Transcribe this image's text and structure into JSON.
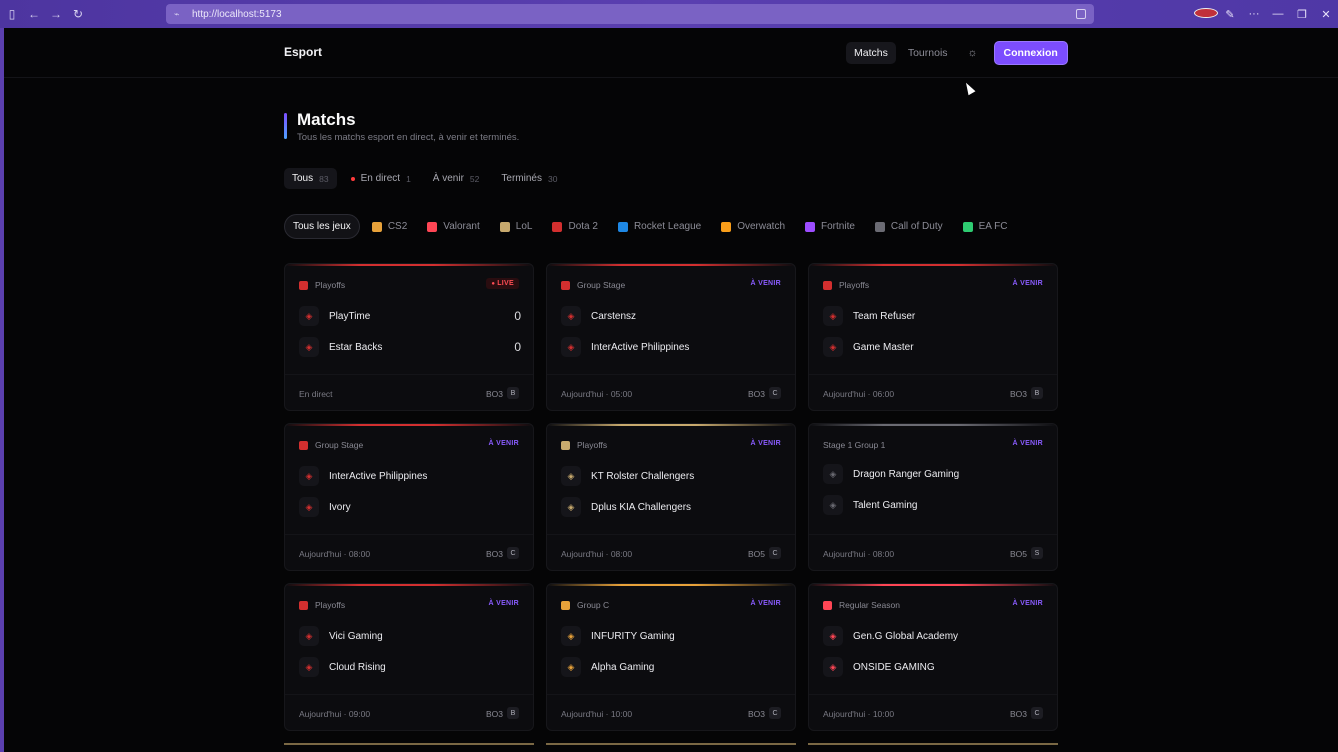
{
  "browser": {
    "url": "http://localhost:5173"
  },
  "nav": {
    "brand": "Esport",
    "links": [
      "Matchs",
      "Tournois"
    ],
    "login": "Connexion"
  },
  "hero": {
    "title": "Matchs",
    "subtitle": "Tous les matchs esport en direct, à venir et terminés."
  },
  "status_tabs": [
    {
      "label": "Tous",
      "count": "83"
    },
    {
      "label": "En direct",
      "count": "1"
    },
    {
      "label": "À venir",
      "count": "52"
    },
    {
      "label": "Terminés",
      "count": "30"
    }
  ],
  "game_filters": [
    {
      "label": "Tous les jeux",
      "color": ""
    },
    {
      "label": "CS2",
      "color": "#e8a23a"
    },
    {
      "label": "Valorant",
      "color": "#ff4655"
    },
    {
      "label": "LoL",
      "color": "#c8aa6e"
    },
    {
      "label": "Dota 2",
      "color": "#d32f2f"
    },
    {
      "label": "Rocket League",
      "color": "#1e88e5"
    },
    {
      "label": "Overwatch",
      "color": "#f99e1a"
    },
    {
      "label": "Fortnite",
      "color": "#9d4dff"
    },
    {
      "label": "Call of Duty",
      "color": "#6b6b73"
    },
    {
      "label": "EA FC",
      "color": "#2ecc71"
    }
  ],
  "matches": [
    {
      "stage": "Playoffs",
      "game_color": "#d32f2f",
      "accent": "#d32f2f",
      "badge": "LIVE",
      "live": true,
      "team1": "PlayTime",
      "team2": "Estar Backs",
      "score1": "0",
      "score2": "0",
      "when": "En direct",
      "format": "BO3",
      "tier": "B"
    },
    {
      "stage": "Group Stage",
      "game_color": "#d32f2f",
      "accent": "#d32f2f",
      "badge": "À VENIR",
      "live": false,
      "team1": "Carstensz",
      "team2": "InterActive Philippines",
      "score1": "",
      "score2": "",
      "when": "Aujourd'hui · 05:00",
      "format": "BO3",
      "tier": "C"
    },
    {
      "stage": "Playoffs",
      "game_color": "#d32f2f",
      "accent": "#d32f2f",
      "badge": "À VENIR",
      "live": false,
      "team1": "Team Refuser",
      "team2": "Game Master",
      "score1": "",
      "score2": "",
      "when": "Aujourd'hui · 06:00",
      "format": "BO3",
      "tier": "B"
    },
    {
      "stage": "Group Stage",
      "game_color": "#d32f2f",
      "accent": "#d32f2f",
      "badge": "À VENIR",
      "live": false,
      "team1": "InterActive Philippines",
      "team2": "Ivory",
      "score1": "",
      "score2": "",
      "when": "Aujourd'hui · 08:00",
      "format": "BO3",
      "tier": "C"
    },
    {
      "stage": "Playoffs",
      "game_color": "#c8aa6e",
      "accent": "#c8aa6e",
      "badge": "À VENIR",
      "live": false,
      "team1": "KT Rolster Challengers",
      "team2": "Dplus KIA Challengers",
      "score1": "",
      "score2": "",
      "when": "Aujourd'hui · 08:00",
      "format": "BO5",
      "tier": "C"
    },
    {
      "stage": "Stage 1 Group 1",
      "game_color": "",
      "accent": "#6b6b73",
      "badge": "À VENIR",
      "live": false,
      "team1": "Dragon Ranger Gaming",
      "team2": "Talent Gaming",
      "score1": "",
      "score2": "",
      "when": "Aujourd'hui · 08:00",
      "format": "BO5",
      "tier": "S"
    },
    {
      "stage": "Playoffs",
      "game_color": "#d32f2f",
      "accent": "#d32f2f",
      "badge": "À VENIR",
      "live": false,
      "team1": "Vici Gaming",
      "team2": "Cloud Rising",
      "score1": "",
      "score2": "",
      "when": "Aujourd'hui · 09:00",
      "format": "BO3",
      "tier": "B"
    },
    {
      "stage": "Group C",
      "game_color": "#e8a23a",
      "accent": "#e8a23a",
      "badge": "À VENIR",
      "live": false,
      "team1": "INFURITY Gaming",
      "team2": "Alpha Gaming",
      "score1": "",
      "score2": "",
      "when": "Aujourd'hui · 10:00",
      "format": "BO3",
      "tier": "C"
    },
    {
      "stage": "Regular Season",
      "game_color": "#ff4655",
      "accent": "#ff4655",
      "badge": "À VENIR",
      "live": false,
      "team1": "Gen.G Global Academy",
      "team2": "ONSIDE GAMING",
      "score1": "",
      "score2": "",
      "when": "Aujourd'hui · 10:00",
      "format": "BO3",
      "tier": "C"
    }
  ],
  "accents": {
    "primary": "#7c4dff",
    "live": "#ff3b3b",
    "background": "#050506"
  }
}
